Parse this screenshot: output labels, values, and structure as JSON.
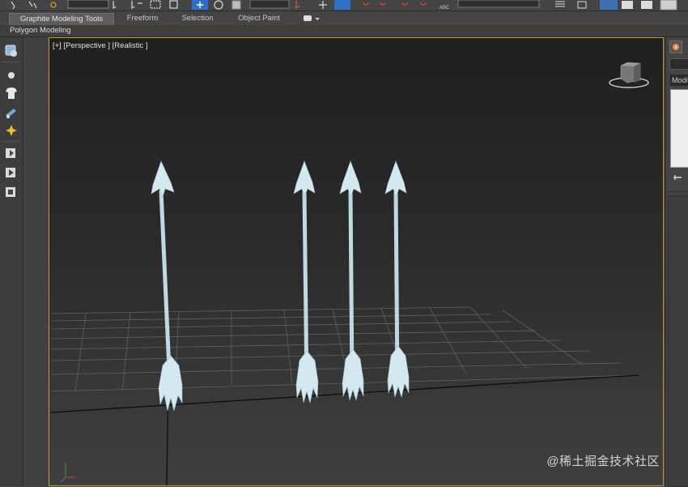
{
  "ribbon": {
    "tabs": [
      "Graphite Modeling Tools",
      "Freeform",
      "Selection",
      "Object Paint"
    ],
    "active_tab": "Graphite Modeling Tools",
    "panel_label": "Polygon Modeling"
  },
  "viewport": {
    "label": "[+] [Perspective ] [Realistic ]",
    "shading": "Realistic",
    "view": "Perspective"
  },
  "command_panel": {
    "modifier_label": "Modifi"
  },
  "scene": {
    "object_count": 4,
    "object_type": "arrow",
    "object_color": "#cfe6ee",
    "grid_color": "#6b6b6b",
    "background_top": "#1f1f1f",
    "background_bottom": "#3e3e3e"
  },
  "colors": {
    "viewport_border": "#b89d38",
    "ui_background": "#444444",
    "accent_blue": "#2d6fc2"
  },
  "watermark": "@稀土掘金技术社区"
}
